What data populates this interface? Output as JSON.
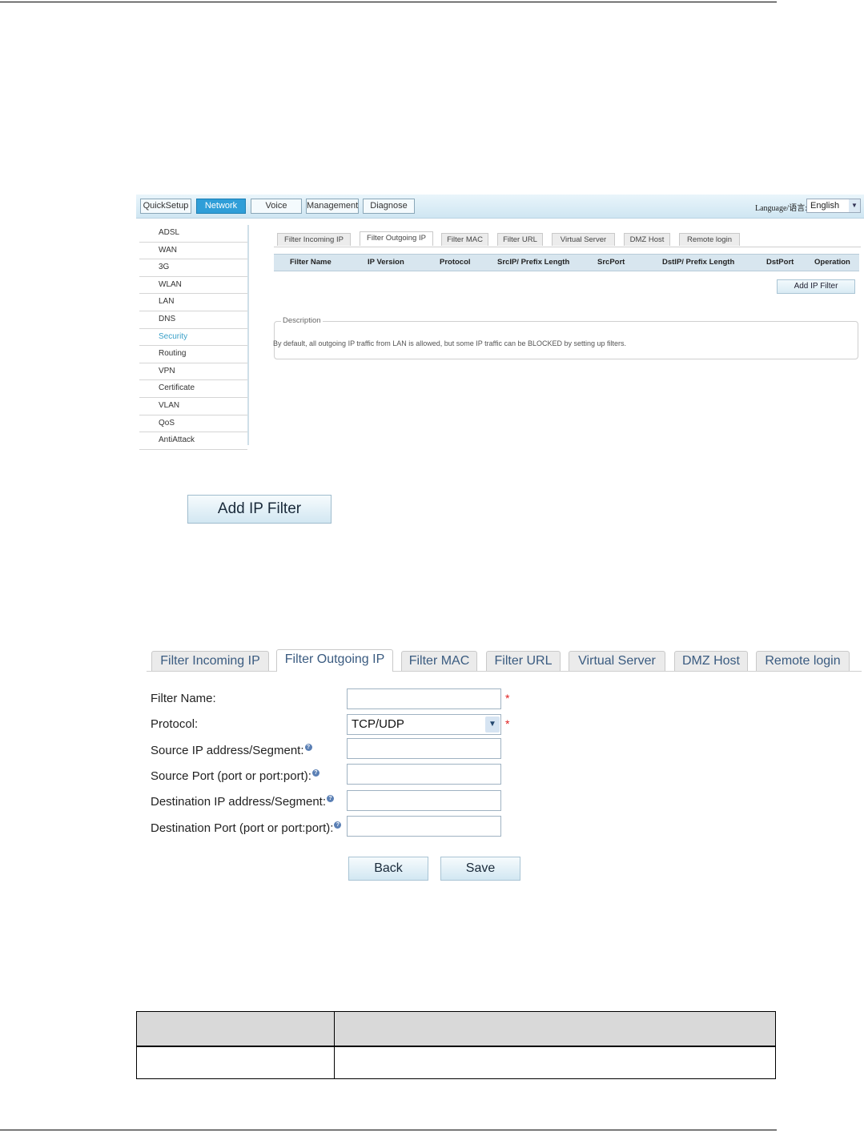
{
  "screenshot1": {
    "main_tabs": [
      "QuickSetup",
      "Network",
      "Voice",
      "Management",
      "Diagnose"
    ],
    "active_main_tab": "Network",
    "language_label": "Language/语言:",
    "language_value": "English",
    "sidebar": [
      "ADSL",
      "WAN",
      "3G",
      "WLAN",
      "LAN",
      "DNS",
      "Security",
      "Routing",
      "VPN",
      "Certificate",
      "VLAN",
      "QoS",
      "AntiAttack"
    ],
    "active_sidebar": "Security",
    "sub_tabs": [
      "Filter Incoming IP",
      "Filter Outgoing IP",
      "Filter MAC",
      "Filter URL",
      "Virtual Server",
      "DMZ Host",
      "Remote login"
    ],
    "active_sub_tab": "Filter Outgoing IP",
    "table_headers": [
      "Filter Name",
      "IP Version",
      "Protocol",
      "SrcIP/ Prefix Length",
      "SrcPort",
      "DstIP/ Prefix Length",
      "DstPort",
      "Operation"
    ],
    "add_button": "Add IP Filter",
    "description_title": "Description",
    "description_text": "By default, all outgoing IP traffic from LAN is allowed, but some IP traffic can be BLOCKED by setting up filters."
  },
  "add_button_large": "Add IP Filter",
  "screenshot2": {
    "tabs": [
      "Filter Incoming IP",
      "Filter Outgoing IP",
      "Filter MAC",
      "Filter URL",
      "Virtual Server",
      "DMZ Host",
      "Remote login"
    ],
    "active_tab": "Filter Outgoing IP",
    "fields": {
      "filter_name": {
        "label": "Filter Name:",
        "value": ""
      },
      "protocol": {
        "label": "Protocol:",
        "value": "TCP/UDP"
      },
      "source_ip": {
        "label": "Source IP address/Segment:",
        "value": ""
      },
      "source_port": {
        "label": "Source Port (port or port:port):",
        "value": ""
      },
      "dest_ip": {
        "label": "Destination IP address/Segment:",
        "value": ""
      },
      "dest_port": {
        "label": "Destination Port (port or port:port):",
        "value": ""
      }
    },
    "required_mark": "*",
    "help_glyph": "?",
    "back_button": "Back",
    "save_button": "Save"
  },
  "colors": {
    "active_tab": "#2f9ed8",
    "active_sidebar_text": "#3aa0c8",
    "required_star": "#e02020"
  }
}
